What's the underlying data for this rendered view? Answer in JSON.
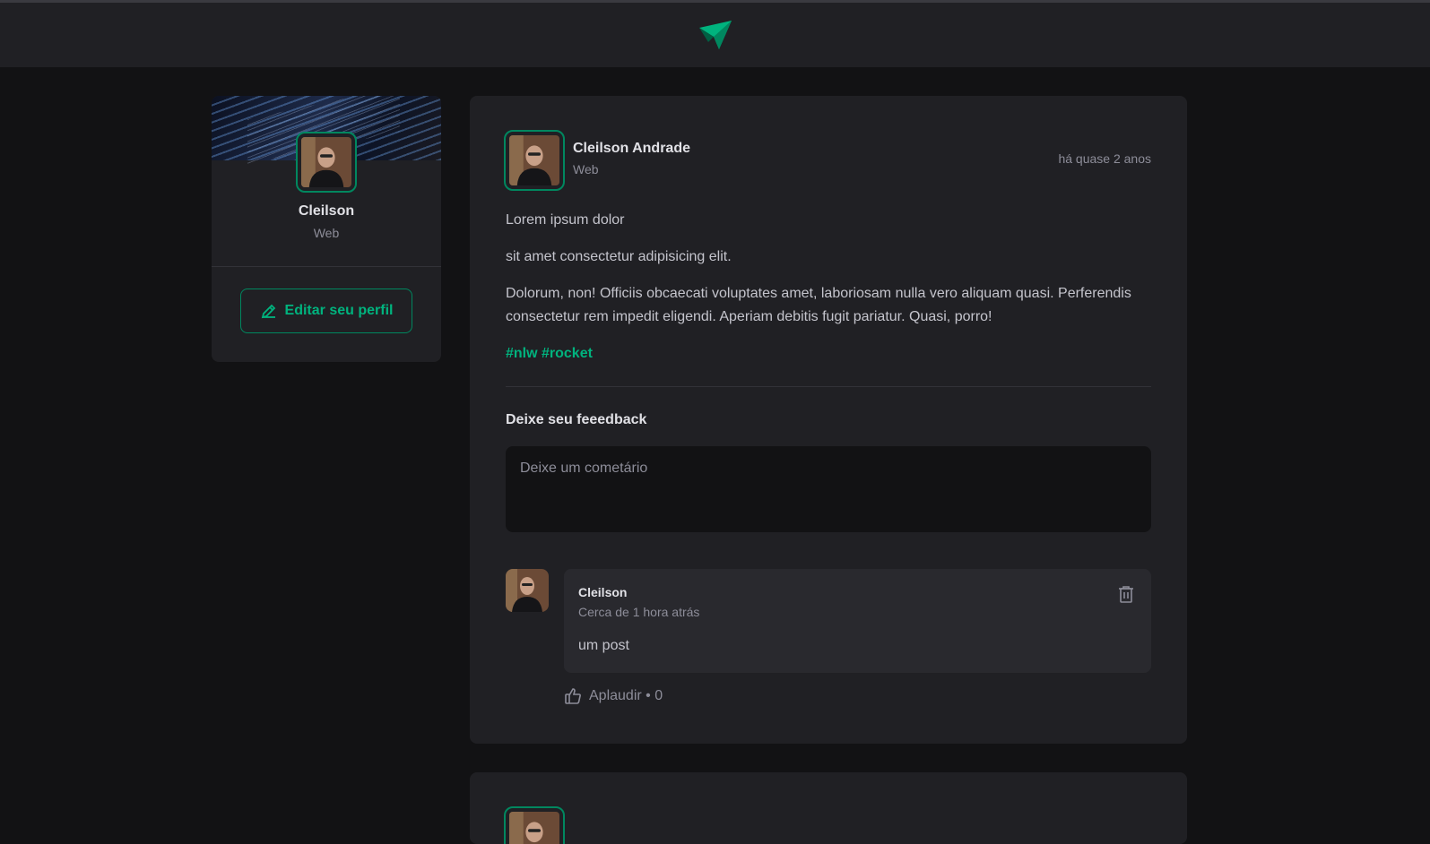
{
  "header": {
    "logo_icon": "paper-plane-icon"
  },
  "colors": {
    "background": "#121214",
    "surface": "#202024",
    "accent": "#00875f",
    "accent_text": "#00b37e"
  },
  "sidebar": {
    "profile_name": "Cleilson",
    "profile_role": "Web",
    "edit_button_label": "Editar seu perfil",
    "edit_icon": "pencil-icon"
  },
  "post": {
    "author_name": "Cleilson Andrade",
    "author_role": "Web",
    "published": "há quase 2 anos",
    "paragraphs": [
      "Lorem ipsum dolor",
      "sit amet consectetur adipisicing elit.",
      "Dolorum, non! Officiis obcaecati voluptates amet, laboriosam nulla vero aliquam quasi. Perferendis consectetur rem impedit eligendi. Aperiam debitis fugit pariatur. Quasi, porro!"
    ],
    "tags": "#nlw #rocket",
    "feedback_title": "Deixe seu feeedback",
    "comment_placeholder": "Deixe um cometário"
  },
  "comment": {
    "author": "Cleilson",
    "time": "Cerca de 1 hora atrás",
    "text": "um post",
    "delete_icon": "trash-icon",
    "applaud_icon": "thumbs-up-icon",
    "applaud_label": "Aplaudir • 0"
  }
}
